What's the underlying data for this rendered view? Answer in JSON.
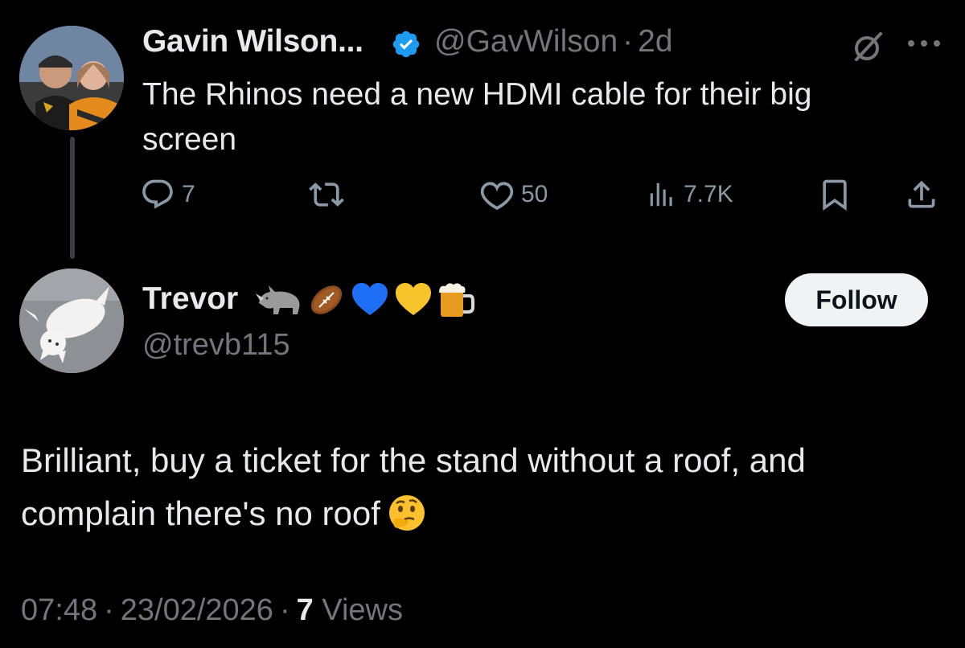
{
  "parent_tweet": {
    "author_name": "Gavin Wilson...",
    "handle": "@GavWilson",
    "separator": "·",
    "time_ago": "2d",
    "text": "The Rhinos need a new HDMI cable for their big screen",
    "actions": {
      "reply_count": "7",
      "retweet_count": "",
      "like_count": "50",
      "view_count": "7.7K"
    },
    "icons": [
      "verified-badge-icon",
      "grok-icon",
      "more-icon",
      "reply-icon",
      "retweet-icon",
      "like-icon",
      "views-icon",
      "bookmark-icon",
      "share-icon"
    ]
  },
  "reply_tweet": {
    "author_name": "Trevor",
    "name_emojis": [
      "rhino",
      "rugby-football",
      "blue-heart",
      "yellow-heart",
      "beer-mug"
    ],
    "handle": "@trevb115",
    "follow_label": "Follow",
    "text": "Brilliant, buy a ticket for the stand without a roof, and complain there's no roof",
    "text_emoji": "thinking-face",
    "time": "07:48",
    "separator": "·",
    "date": "23/02/2026",
    "views_count": "7",
    "views_label": "Views"
  },
  "colors": {
    "background": "#000000",
    "primary_text": "#e7e9ea",
    "secondary_text": "#71767b",
    "icon_gray": "#8b98a5",
    "verified_blue": "#1d9bf0",
    "follow_bg": "#eff3f4",
    "follow_text": "#0f1419"
  }
}
